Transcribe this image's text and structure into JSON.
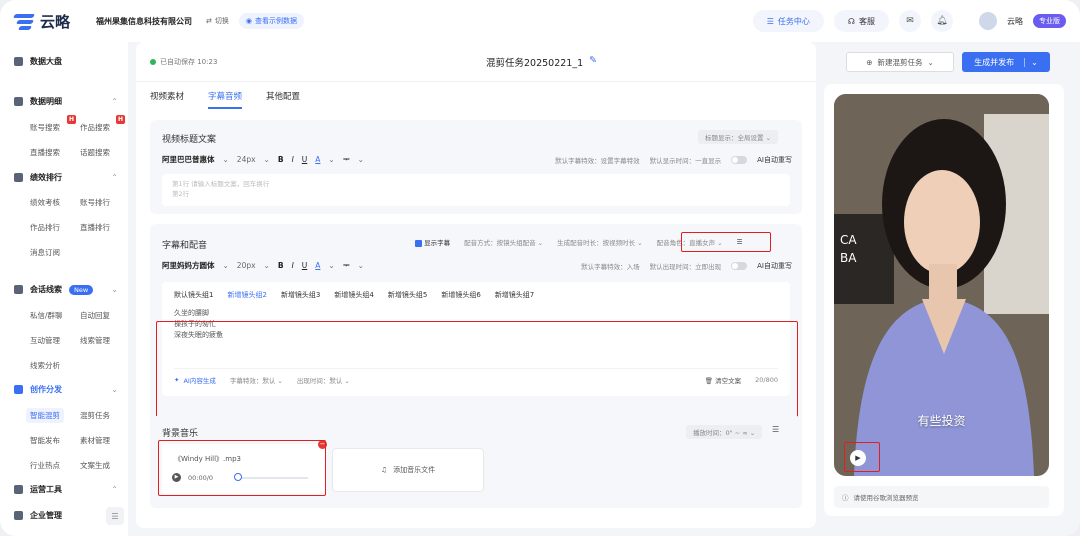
{
  "brand": {
    "logo_text": "云略",
    "company": "福州果集信息科技有限公司",
    "switch_label": "切换",
    "demo_label": "查看示例数据"
  },
  "topnav": {
    "task_center": "任务中心",
    "support": "客服",
    "username": "云略",
    "plan_badge": "专业版"
  },
  "sidebar": {
    "sections": [
      {
        "label": "数据大盘",
        "icon": "dashboard-icon"
      },
      {
        "label": "数据明细",
        "icon": "data-icon"
      },
      {
        "label": "绩效排行",
        "icon": "rank-icon"
      },
      {
        "label": "会话线索",
        "icon": "chat-icon",
        "badge": "New"
      },
      {
        "label": "创作分发",
        "icon": "create-icon"
      },
      {
        "label": "运营工具",
        "icon": "tools-icon"
      },
      {
        "label": "企业管理",
        "icon": "enterprise-icon"
      }
    ],
    "items": [
      "账号搜索",
      "作品搜索",
      "直播搜索",
      "话题搜索",
      "绩效考核",
      "账号排行",
      "作品排行",
      "直播排行",
      "消息订阅",
      "私信/群聊",
      "自动回复",
      "互动管理",
      "线索管理",
      "线索分析",
      "智能混剪",
      "混剪任务",
      "智能发布",
      "素材管理",
      "行业热点",
      "文案生成"
    ],
    "hot_badge": "H"
  },
  "header": {
    "autosave": "已自动保存 10:23",
    "task_name": "混剪任务20250221_1",
    "new_task": "新建混剪任务",
    "generate_publish": "生成并发布"
  },
  "tabs": [
    "视频素材",
    "字幕音频",
    "其他配置"
  ],
  "title_copy": {
    "heading": "视频标题文案",
    "display_select": "标题显示：全局设置",
    "font": "阿里巴巴普惠体",
    "size": "24px",
    "effect": "默认字幕特效：设置字幕特效",
    "display_time": "默认显示时间：一直显示",
    "ai_rewrite": "AI自动重写",
    "placeholder_line1": "第1行    请输入标题文案，回车换行",
    "placeholder_line2": "第2行"
  },
  "subtitle": {
    "heading": "字幕和配音",
    "show_subtitle": "显示字幕",
    "dub_mode": "配音方式：按镜头组配音",
    "dub_duration": "生成配音时长：按视频时长",
    "dub_role": "配音角色：直播女声",
    "font": "阿里妈妈方圆体",
    "size": "20px",
    "effect": "默认字幕特效：入场",
    "appear": "默认出现时间：立即出现",
    "ai_rewrite": "AI自动重写",
    "groups": [
      "默认镜头组1",
      "新增镜头组2",
      "新增镜头组3",
      "新增镜头组4",
      "新增镜头组5",
      "新增镜头组6",
      "新增镜头组7"
    ],
    "lyrics": [
      "久坐的腰脚",
      "操孩子的匆忙",
      "深夜失眠的疲惫"
    ],
    "ai_generate": "AI内容生成",
    "sub_effect": "字幕特效：默认",
    "sub_appear": "出现时间：默认",
    "clear": "清空文案",
    "count": "20/800"
  },
  "music": {
    "heading": "背景音乐",
    "play_time": "播放时间：0\" ~ ∞",
    "file_name": "《Windy Hill》.mp3",
    "time": "00:00/0",
    "add_label": "添加音乐文件"
  },
  "preview": {
    "subtitle": "有些投资",
    "note": "请使用谷歌浏览器预览",
    "overlay_text": "CA BA"
  }
}
